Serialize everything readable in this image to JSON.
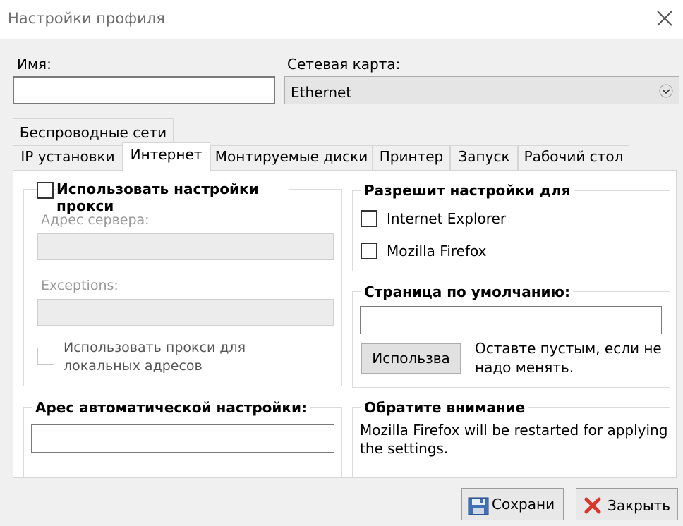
{
  "window": {
    "title": "Настройки профиля"
  },
  "name_field": {
    "label": "Имя:",
    "value": ""
  },
  "network_card": {
    "label": "Сетевая карта:",
    "selected": "Ethernet"
  },
  "tabs": {
    "row1": [
      {
        "label": "Беспроводные сети"
      }
    ],
    "row2": [
      {
        "label": "IP установки"
      },
      {
        "label": "Интернет",
        "active": true
      },
      {
        "label": "Монтируемые диски"
      },
      {
        "label": "Принтер"
      },
      {
        "label": "Запуск"
      },
      {
        "label": "Рабочий стол"
      }
    ]
  },
  "proxy": {
    "checkbox_label": "Использовать настройки прокси",
    "checked": false,
    "server_address_label": "Адрес сервера:",
    "server_address_value": "",
    "exceptions_label": "Exceptions:",
    "exceptions_value": "",
    "local_checkbox_label_line1": "Использовать прокси для",
    "local_checkbox_label_line2": "локальных адресов",
    "local_checked": false
  },
  "auto_config": {
    "title": "Арес автоматической настройки:",
    "value": ""
  },
  "allow_settings": {
    "title": "Разрешит настройки для",
    "items": [
      {
        "label": "Internet Explorer",
        "checked": false
      },
      {
        "label": "Mozilla Firefox",
        "checked": false
      }
    ]
  },
  "default_page": {
    "title": "Страница по умолчанию:",
    "value": "",
    "use_button": "Использва",
    "hint_line1": "Оставте пустым, если не",
    "hint_line2": "надо менять."
  },
  "notice": {
    "title": "Обратите внимание",
    "text_line1": "Mozilla Firefox will be restarted for applying",
    "text_line2": "the settings."
  },
  "footer": {
    "save_label": "Сохрани",
    "close_label": "Закрыть"
  },
  "colors": {
    "accent": "#0078d7",
    "border": "#7a7a7a",
    "panel": "#ffffff",
    "window": "#f0f0f0"
  }
}
